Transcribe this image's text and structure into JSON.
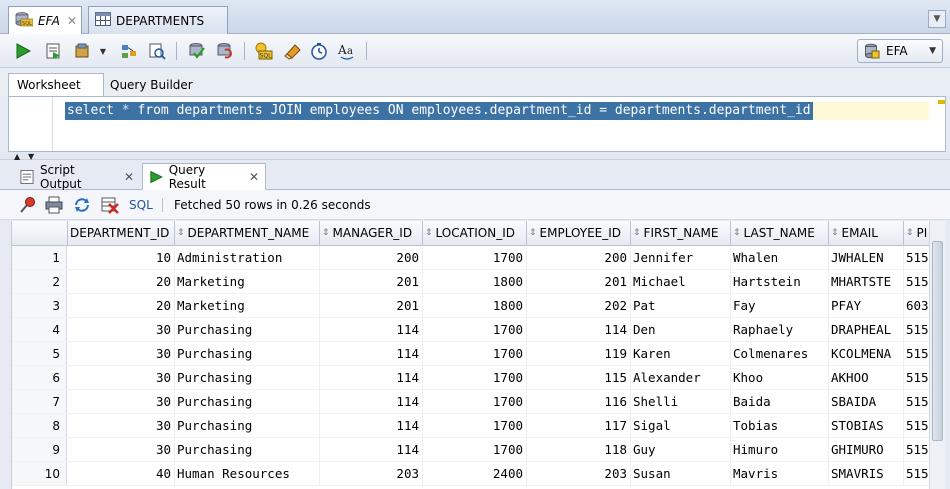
{
  "editor_tabs": [
    {
      "label": "EFA",
      "active": true
    },
    {
      "label": "DEPARTMENTS",
      "active": false
    }
  ],
  "toolbar": {
    "connection": "EFA",
    "icons": [
      "run-statement-icon",
      "run-script-icon",
      "commit-icon",
      "dropdown-arrow-icon",
      "explain-plan-icon",
      "autotrace-icon",
      "commit-icon",
      "rollback-icon",
      "sql-tuning-icon",
      "clear-icon",
      "history-icon",
      "format-case-icon"
    ]
  },
  "worksheet_tabs": [
    {
      "label": "Worksheet",
      "active": true
    },
    {
      "label": "Query Builder",
      "active": false
    }
  ],
  "editor": {
    "sql_before_star": "select ",
    "sql_star": "*",
    "sql_after_star": " from departments JOIN employees ON employees.department_id = departments.department_id"
  },
  "result_tabs": [
    {
      "label": "Script Output",
      "active": false
    },
    {
      "label": "Query Result",
      "active": true
    }
  ],
  "result_toolbar": {
    "sql_link": "SQL",
    "status": "Fetched 50 rows in 0.26 seconds"
  },
  "colors": {
    "selection": "#3d72a5",
    "run_green": "#2a9d2a"
  },
  "grid": {
    "columns": [
      "DEPARTMENT_ID",
      "DEPARTMENT_NAME",
      "MANAGER_ID",
      "LOCATION_ID",
      "EMPLOYEE_ID",
      "FIRST_NAME",
      "LAST_NAME",
      "EMAIL",
      "PI"
    ],
    "rows": [
      [
        "1",
        "10",
        "Administration",
        "200",
        "1700",
        "200",
        "Jennifer",
        "Whalen",
        "JWHALEN",
        "515"
      ],
      [
        "2",
        "20",
        "Marketing",
        "201",
        "1800",
        "201",
        "Michael",
        "Hartstein",
        "MHARTSTE",
        "515"
      ],
      [
        "3",
        "20",
        "Marketing",
        "201",
        "1800",
        "202",
        "Pat",
        "Fay",
        "PFAY",
        "603"
      ],
      [
        "4",
        "30",
        "Purchasing",
        "114",
        "1700",
        "114",
        "Den",
        "Raphaely",
        "DRAPHEAL",
        "515"
      ],
      [
        "5",
        "30",
        "Purchasing",
        "114",
        "1700",
        "119",
        "Karen",
        "Colmenares",
        "KCOLMENA",
        "515"
      ],
      [
        "6",
        "30",
        "Purchasing",
        "114",
        "1700",
        "115",
        "Alexander",
        "Khoo",
        "AKHOO",
        "515"
      ],
      [
        "7",
        "30",
        "Purchasing",
        "114",
        "1700",
        "116",
        "Shelli",
        "Baida",
        "SBAIDA",
        "515"
      ],
      [
        "8",
        "30",
        "Purchasing",
        "114",
        "1700",
        "117",
        "Sigal",
        "Tobias",
        "STOBIAS",
        "515"
      ],
      [
        "9",
        "30",
        "Purchasing",
        "114",
        "1700",
        "118",
        "Guy",
        "Himuro",
        "GHIMURO",
        "515"
      ],
      [
        "10",
        "40",
        "Human Resources",
        "203",
        "2400",
        "203",
        "Susan",
        "Mavris",
        "SMAVRIS",
        "515"
      ]
    ]
  }
}
